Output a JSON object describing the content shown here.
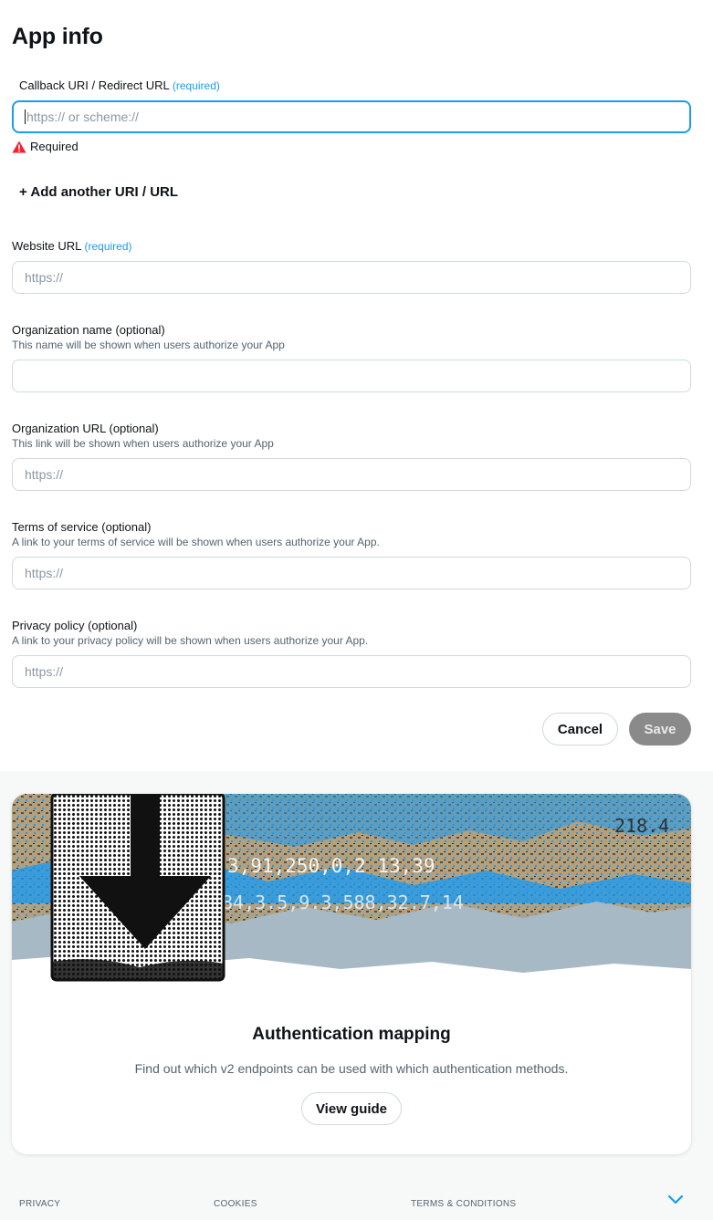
{
  "page": {
    "title": "App info"
  },
  "callback": {
    "label": "Callback URI / Redirect URL",
    "required_tag": "(required)",
    "placeholder": "https:// or scheme://",
    "value": "",
    "error": "Required"
  },
  "add_uri": {
    "label": "+ Add another URI / URL"
  },
  "website": {
    "label": "Website URL",
    "required_tag": "(required)",
    "placeholder": "https://",
    "value": ""
  },
  "org_name": {
    "label": "Organization name",
    "optional_tag": "(optional)",
    "help": "This name will be shown when users authorize your App",
    "placeholder": "",
    "value": ""
  },
  "org_url": {
    "label": "Organization URL",
    "optional_tag": "(optional)",
    "help": "This link will be shown when users authorize your App",
    "placeholder": "https://",
    "value": ""
  },
  "terms": {
    "label": "Terms of service",
    "optional_tag": "(optional)",
    "help": "A link to your terms of service will be shown when users authorize your App.",
    "placeholder": "https://",
    "value": ""
  },
  "privacy": {
    "label": "Privacy policy",
    "optional_tag": "(optional)",
    "help": "A link to your privacy policy will be shown when users authorize your App.",
    "placeholder": "https://",
    "value": ""
  },
  "actions": {
    "cancel": "Cancel",
    "save": "Save"
  },
  "promo": {
    "art_text_row1": "218.4",
    "art_text_row2": "3,91,250,0,2 13,39",
    "art_text_row3": "84,3.5,9.3,588,32.7,14",
    "title": "Authentication mapping",
    "description": "Find out which v2 endpoints can be used with which authentication methods.",
    "button": "View guide"
  },
  "footer": {
    "privacy": "PRIVACY",
    "cookies": "COOKIES",
    "terms": "TERMS & CONDITIONS"
  },
  "colors": {
    "accent": "#1d9bf0",
    "error": "#f4212e",
    "save_disabled": "#8a8a8a"
  }
}
